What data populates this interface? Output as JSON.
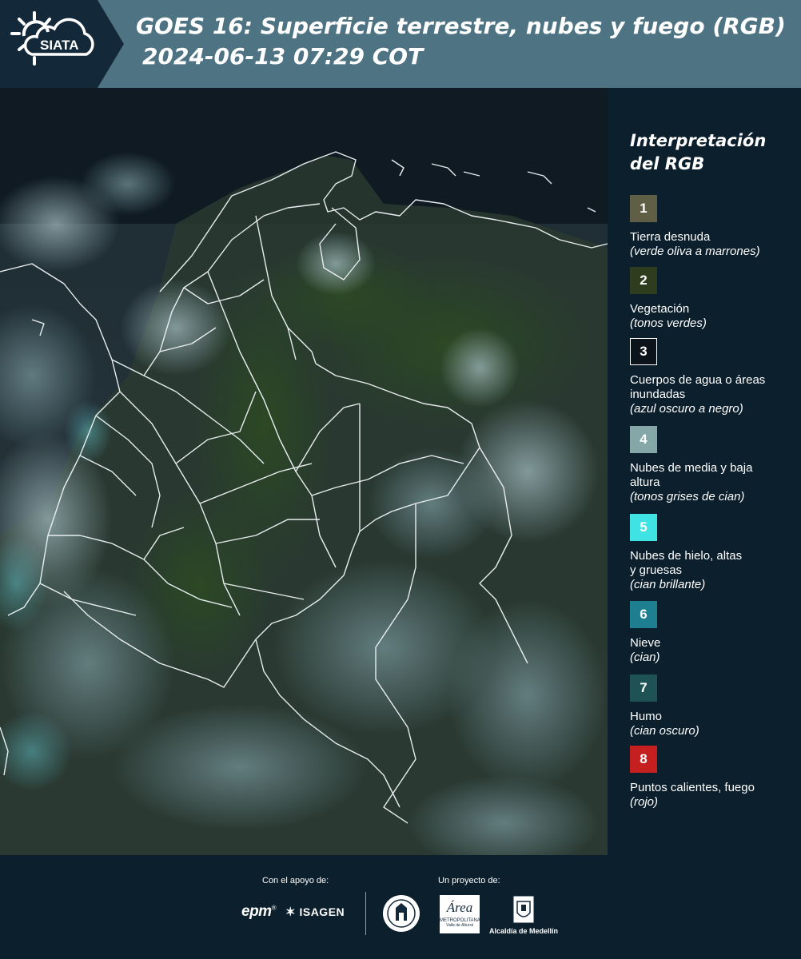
{
  "header": {
    "logo_text": "SIATA",
    "title_line1": "GOES 16: Superficie terrestre, nubes y fuego (RGB)",
    "title_line2": "2024-06-13 07:29 COT"
  },
  "legend": {
    "title_line1": "Interpretación",
    "title_line2": "del RGB",
    "items": [
      {
        "number": "1",
        "color": "#5f5f46",
        "label": "Tierra desnuda",
        "note": "(verde oliva a marrones)"
      },
      {
        "number": "2",
        "color": "#2e3d1e",
        "label": "Vegetación",
        "note": "(tonos verdes)"
      },
      {
        "number": "3",
        "color": "#0b141a",
        "label": "Cuerpos de agua o áreas inundadas",
        "note": "(azul oscuro a negro)"
      },
      {
        "number": "4",
        "color": "#86a7a8",
        "label": "Nubes de media y baja altura",
        "note": "(tonos grises de cian)"
      },
      {
        "number": "5",
        "color": "#3fe3e3",
        "label": "Nubes de hielo, altas y gruesas",
        "note": "(cian brillante)"
      },
      {
        "number": "6",
        "color": "#1d7f90",
        "label": "Nieve",
        "note": "(cian)"
      },
      {
        "number": "7",
        "color": "#1e5254",
        "label": "Humo",
        "note": "(cian oscuro)"
      },
      {
        "number": "8",
        "color": "#c5201f",
        "label": "Puntos calientes, fuego",
        "note": "(rojo)"
      }
    ]
  },
  "footer": {
    "support_label": "Con el apoyo de:",
    "project_label": "Un proyecto de:",
    "epm": "epm",
    "isagen": "ISAGEN",
    "area_name": "Área",
    "area_sub": "METROPOLITANA",
    "area_sub2": "Valle de Aburrá",
    "alcaldia": "Alcaldía de Medellín"
  }
}
